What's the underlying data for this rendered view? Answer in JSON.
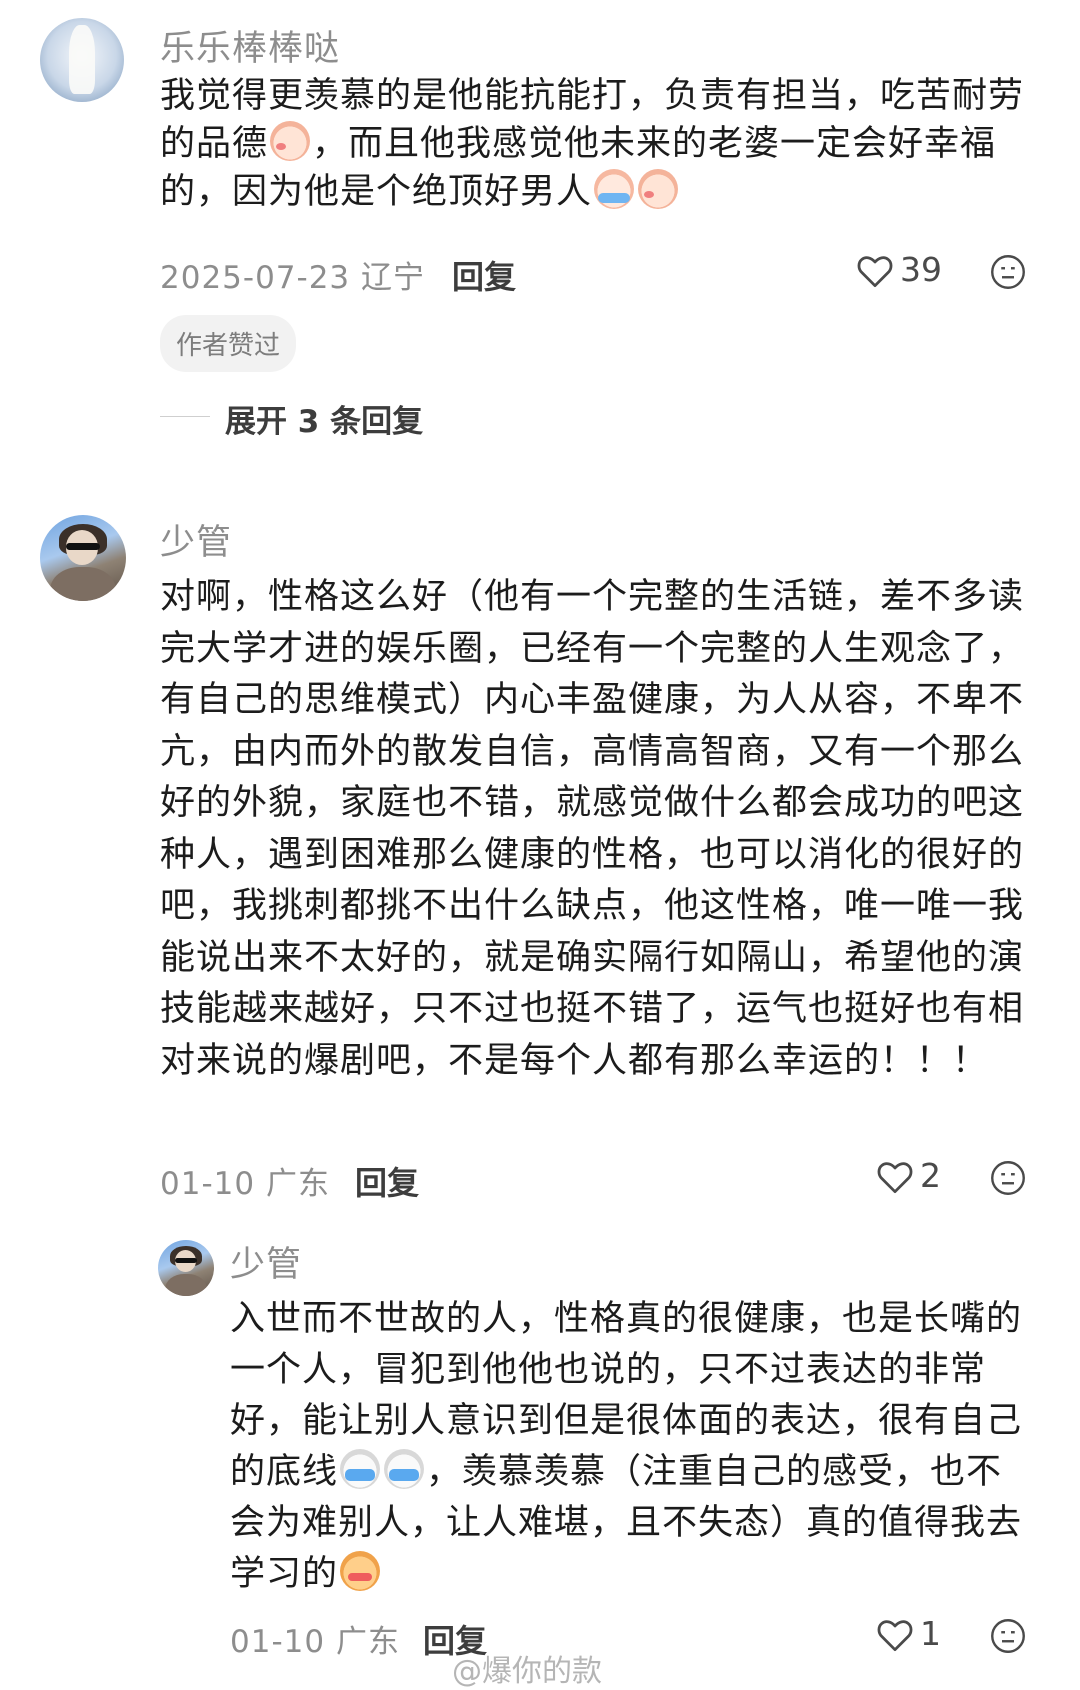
{
  "comments": [
    {
      "username": "乐乐棒棒哒",
      "text_parts": [
        "我觉得更羡慕的是他能抗能打，负责有担当，吃苦耐劳的品德",
        "，而且他我感觉他未来的老婆一定会好幸福的，因为他是个绝顶好男人"
      ],
      "date": "2025-07-23",
      "location": "辽宁",
      "reply_label": "回复",
      "likes": "39",
      "badge": "作者赞过",
      "expand_label": "展开 3 条回复"
    },
    {
      "username": "少管",
      "text": "对啊，性格这么好（他有一个完整的生活链，差不多读完大学才进的娱乐圈，已经有一个完整的人生观念了，有自己的思维模式）内心丰盈健康，为人从容，不卑不亢，由内而外的散发自信，高情高智商，又有一个那么好的外貌，家庭也不错，就感觉做什么都会成功的吧这种人，遇到困难那么健康的性格，也可以消化的很好的吧，我挑刺都挑不出什么缺点，他这性格，唯一唯一我能说出来不太好的，就是确实隔行如隔山，希望他的演技能越来越好，只不过也挺不错了，运气也挺好也有相对来说的爆剧吧，不是每个人都有那么幸运的！！！",
      "date": "01-10",
      "location": "广东",
      "reply_label": "回复",
      "likes": "2"
    },
    {
      "username": "少管",
      "text_parts": [
        "入世而不世故的人，性格真的很健康，也是长嘴的一个人，冒犯到他他也说的，只不过表达的非常好，能让别人意识到但是很体面的表达，很有自己的底线",
        "，羡慕羡慕（注重自己的感受，也不会为难别人，让人难堪，且不失态）真的值得我去学习的"
      ],
      "date": "01-10",
      "location": "广东",
      "reply_label": "回复",
      "likes": "1"
    }
  ],
  "watermark": "@爆你的款",
  "icons": {
    "like": "heart-outline-icon",
    "dislike": "unhappy-face-icon",
    "blush_emoji": "blush-peach-emoji-icon",
    "cry_emoji": "crying-emoji-icon",
    "dog_emoji": "crying-dog-emoji-icon",
    "cat_emoji": "angry-cat-emoji-icon"
  }
}
